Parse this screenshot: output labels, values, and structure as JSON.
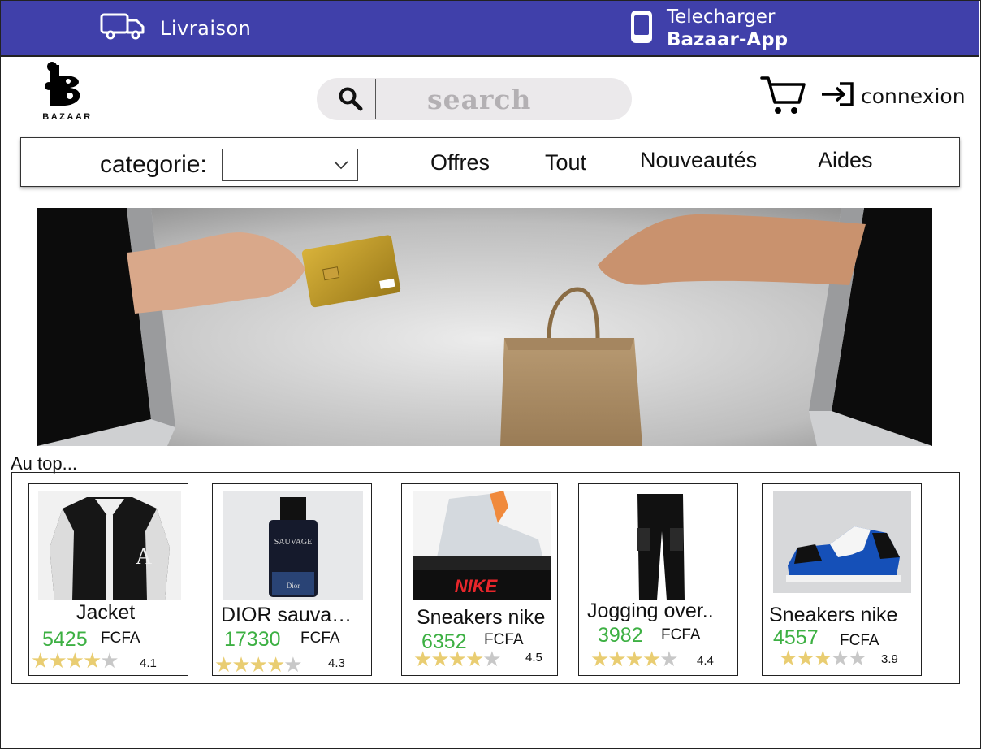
{
  "topbar": {
    "delivery_label": "Livraison",
    "app_line1": "Telecharger",
    "app_line2": "Bazaar-App",
    "color": "#4040aa"
  },
  "logo": {
    "text": "BAZAAR"
  },
  "search": {
    "placeholder": "search"
  },
  "header": {
    "login_label": "connexion"
  },
  "nav": {
    "category_label": "categorie:",
    "category_value": "",
    "links": [
      "Offres",
      "Tout",
      "Nouveautés",
      "Aides"
    ]
  },
  "section": {
    "title": "Au top..."
  },
  "products": [
    {
      "name": "Jacket",
      "price": "5425",
      "currency": "FCFA",
      "rating": "4.1",
      "stars_filled": 4,
      "image": "varsity-jacket"
    },
    {
      "name": "DIOR sauva…",
      "price": "17330",
      "currency": "FCFA",
      "rating": "4.3",
      "stars_filled": 4,
      "image": "perfume-bottle"
    },
    {
      "name": "Sneakers nike",
      "price": "6352",
      "currency": "FCFA",
      "rating": "4.5",
      "stars_filled": 4,
      "image": "high-top-sneaker"
    },
    {
      "name": "Jogging over..",
      "price": "3982",
      "currency": "FCFA",
      "rating": "4.4",
      "stars_filled": 4,
      "image": "cargo-pants"
    },
    {
      "name": "Sneakers nike",
      "price": "4557",
      "currency": "FCFA",
      "rating": "3.9",
      "stars_filled": 3,
      "image": "low-top-sneaker"
    }
  ],
  "colors": {
    "price": "#3db043",
    "star": "#e9cd72",
    "star_empty": "#c8c8c8"
  }
}
